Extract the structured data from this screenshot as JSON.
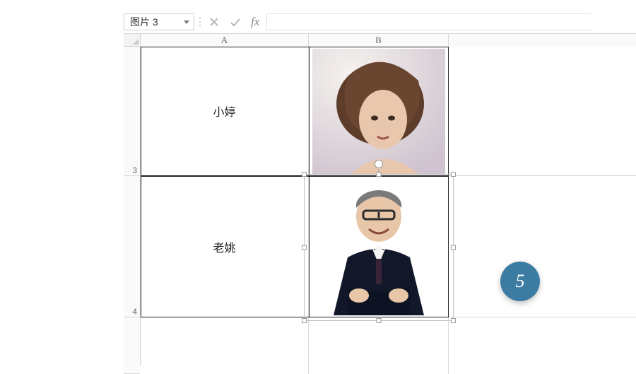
{
  "name_box": {
    "value": "图片 3"
  },
  "formula_bar": {
    "fx_label": "fx",
    "value": ""
  },
  "columns": {
    "A": "A",
    "B": "B"
  },
  "rows": {
    "r3": "3",
    "r4": "4"
  },
  "cells": {
    "A3": "小婷",
    "A4": "老姚"
  },
  "step_badge": "5",
  "colors": {
    "accent": "#3c7ca3"
  }
}
